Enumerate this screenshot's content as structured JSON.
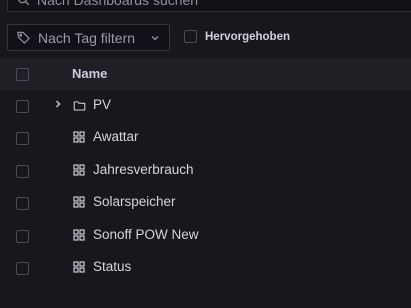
{
  "search": {
    "placeholder": "Nach Dashboards suchen",
    "icon": "search-icon"
  },
  "filters": {
    "tag_filter_label": "Nach Tag filtern",
    "starred_label": "Hervorgehoben",
    "starred_checked": false
  },
  "table": {
    "header": {
      "name": "Name"
    },
    "rows": [
      {
        "label": "PV",
        "type": "folder",
        "icon": "folder-icon",
        "expandable": true
      },
      {
        "label": "Awattar",
        "type": "dashboard",
        "icon": "dashboard-grid-icon"
      },
      {
        "label": "Jahresverbrauch",
        "type": "dashboard",
        "icon": "dashboard-grid-icon"
      },
      {
        "label": "Solarspeicher",
        "type": "dashboard",
        "icon": "dashboard-grid-icon"
      },
      {
        "label": "Sonoff POW New",
        "type": "dashboard",
        "icon": "dashboard-grid-icon"
      },
      {
        "label": "Status",
        "type": "dashboard",
        "icon": "dashboard-grid-icon"
      }
    ]
  },
  "colors": {
    "background": "#17181c",
    "header_row": "#1f2026",
    "text": "#ccccdc",
    "border": "#34363d"
  }
}
